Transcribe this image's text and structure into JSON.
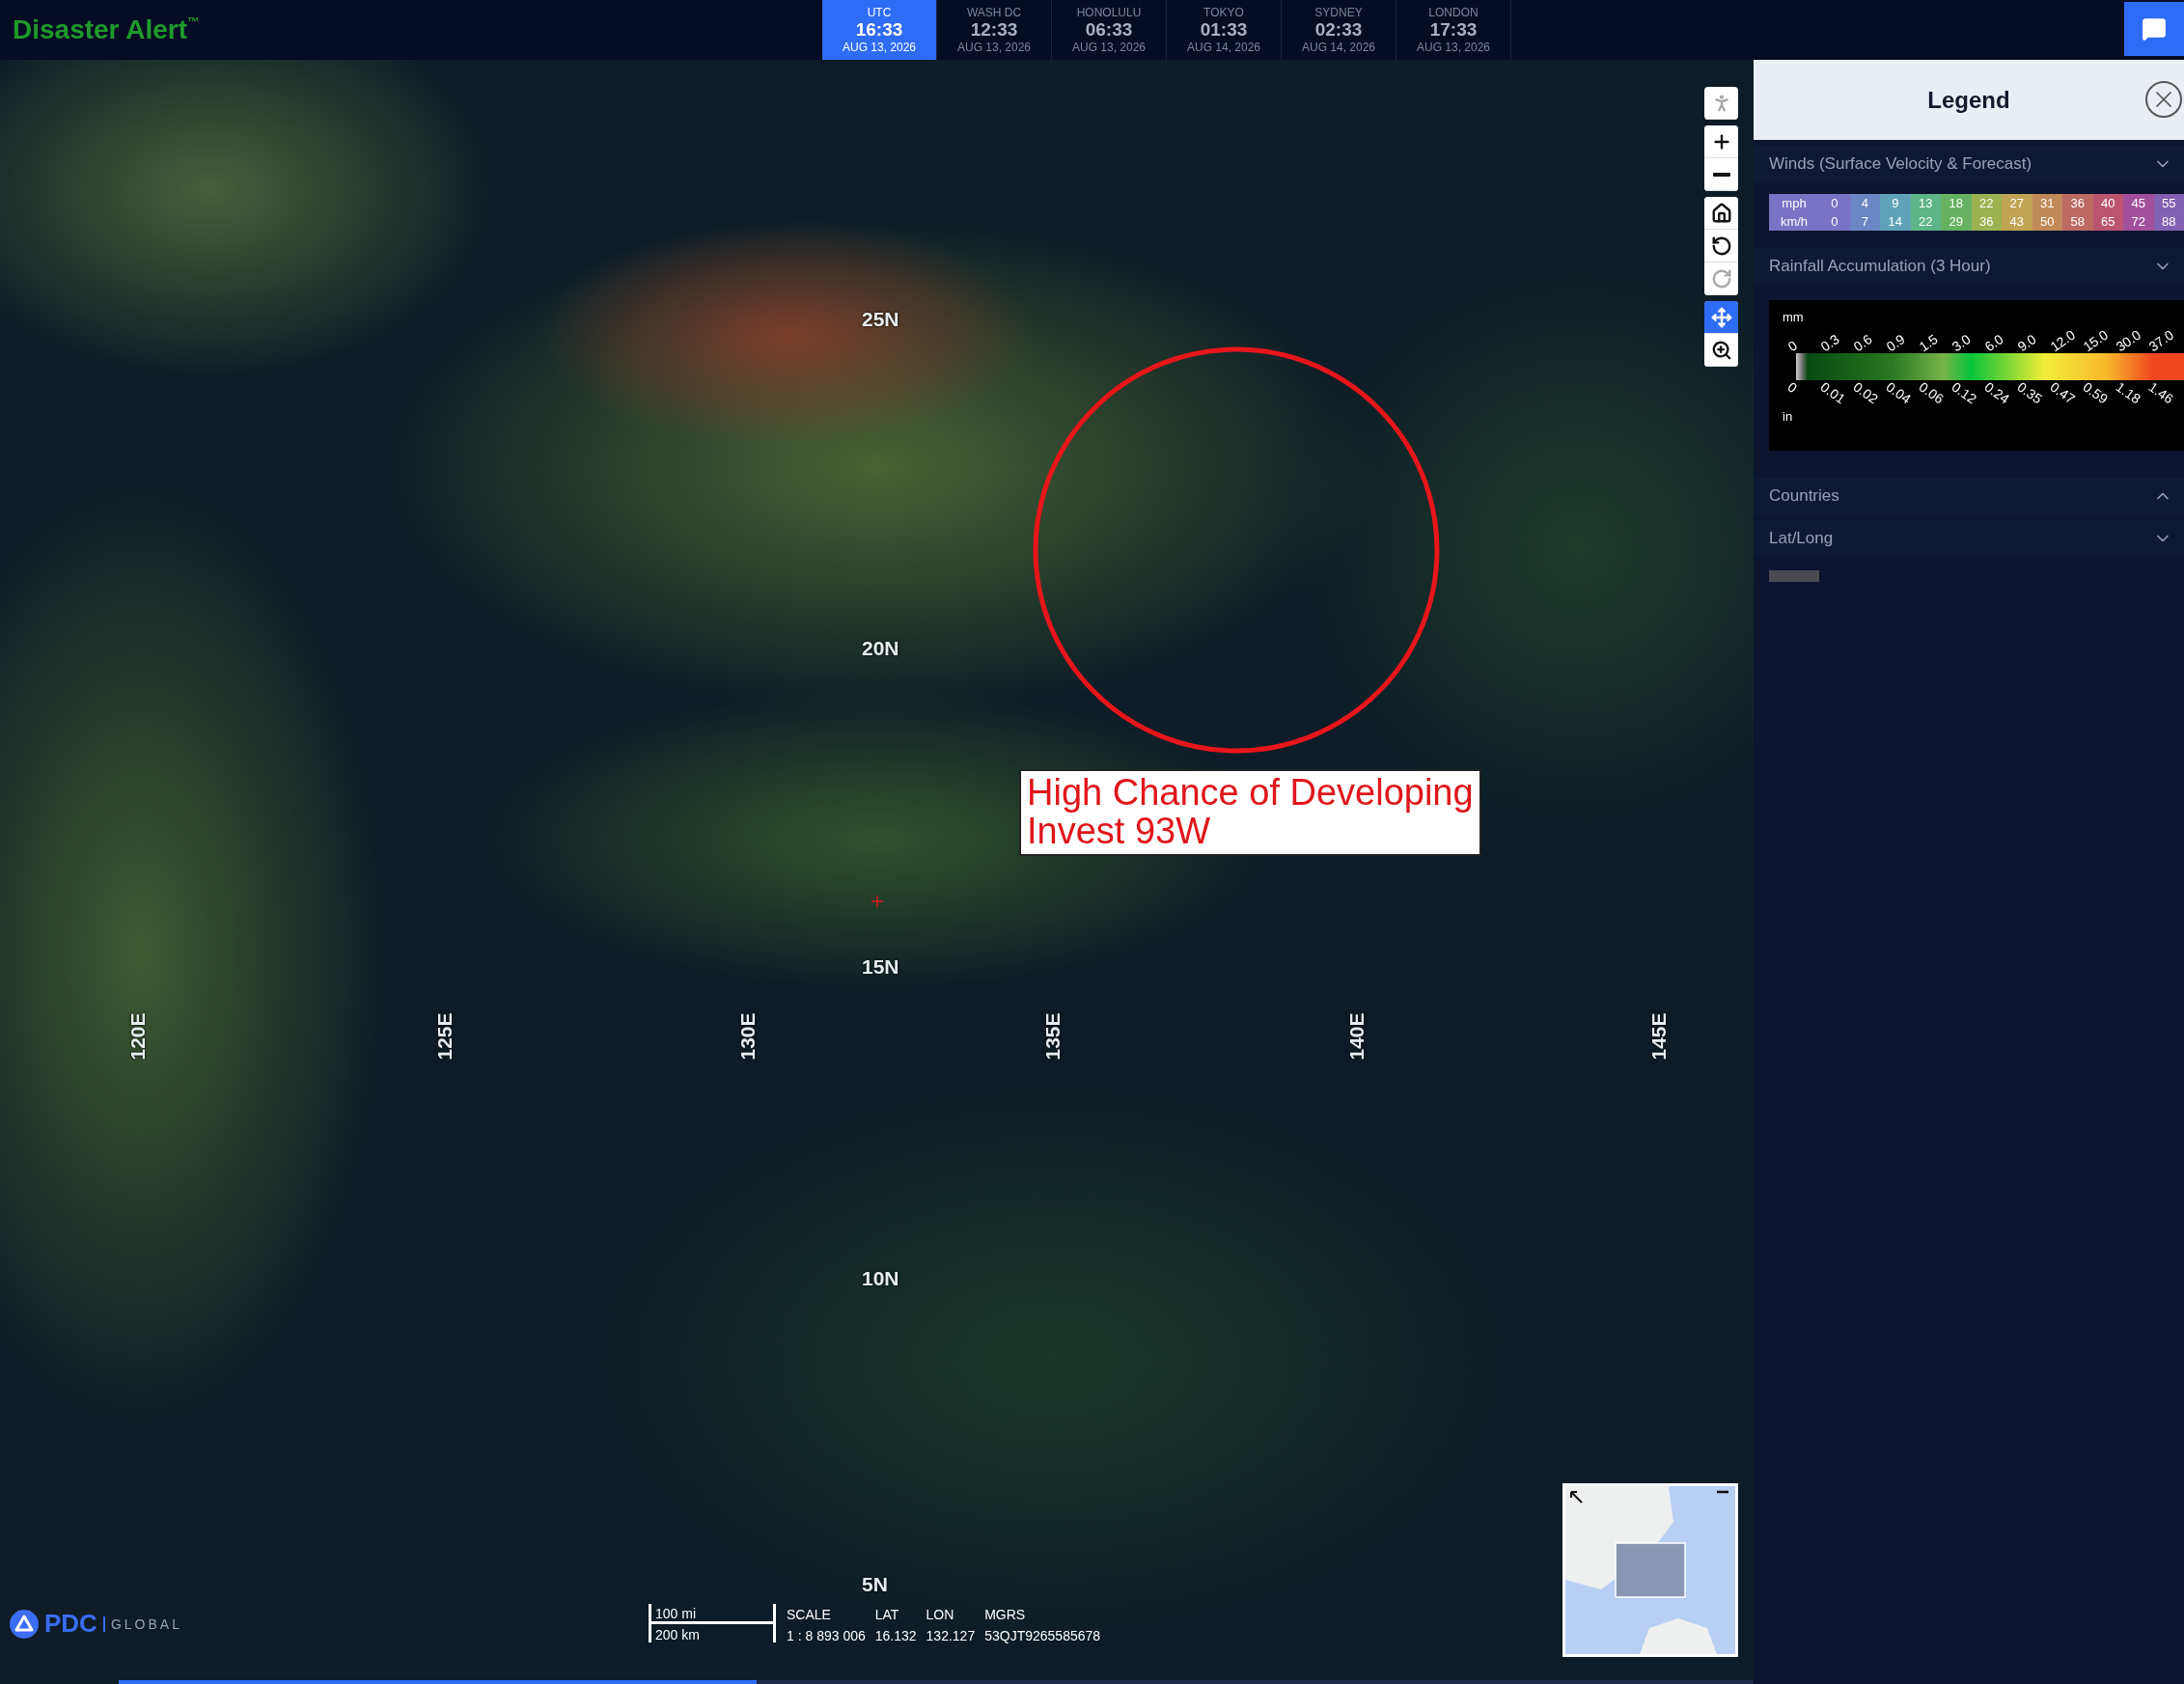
{
  "header": {
    "title": "Disaster Alert",
    "trademark": "™",
    "clocks": [
      {
        "zone": "UTC",
        "time": "16:33",
        "date": "AUG 13, 2026",
        "selected": true
      },
      {
        "zone": "WASH DC",
        "time": "12:33",
        "date": "AUG 13, 2026",
        "selected": false
      },
      {
        "zone": "HONOLULU",
        "time": "06:33",
        "date": "AUG 13, 2026",
        "selected": false
      },
      {
        "zone": "TOKYO",
        "time": "01:33",
        "date": "AUG 14, 2026",
        "selected": false
      },
      {
        "zone": "SYDNEY",
        "time": "02:33",
        "date": "AUG 14, 2026",
        "selected": false
      },
      {
        "zone": "LONDON",
        "time": "17:33",
        "date": "AUG 13, 2026",
        "selected": false
      }
    ]
  },
  "map": {
    "lat_labels": [
      "25N",
      "20N",
      "15N",
      "10N",
      "5N"
    ],
    "lon_labels": [
      "120E",
      "125E",
      "130E",
      "135E",
      "140E",
      "145E"
    ],
    "annotation": {
      "lines": [
        "High Chance of Developing",
        "Invest 93W"
      ]
    },
    "controls": [
      {
        "buttons": [
          {
            "kind": "person",
            "selected": false,
            "disabled": true
          }
        ]
      },
      {
        "buttons": [
          {
            "kind": "zoom-in",
            "selected": false,
            "disabled": false
          },
          {
            "kind": "zoom-out",
            "selected": false,
            "disabled": false
          }
        ]
      },
      {
        "buttons": [
          {
            "kind": "home",
            "selected": false,
            "disabled": false
          },
          {
            "kind": "undo",
            "selected": false,
            "disabled": false
          },
          {
            "kind": "redo",
            "selected": false,
            "disabled": true
          }
        ]
      },
      {
        "buttons": [
          {
            "kind": "pan",
            "selected": true,
            "disabled": false
          },
          {
            "kind": "zoom-box",
            "selected": false,
            "disabled": false
          }
        ]
      }
    ],
    "logo": {
      "name": "PDC",
      "suffix": "GLOBAL"
    },
    "scale_bar": {
      "miles": "100 mi",
      "km": "200 km"
    },
    "readout": [
      {
        "label": "SCALE",
        "value": "1 : 8 893 006"
      },
      {
        "label": "LAT",
        "value": "16.132"
      },
      {
        "label": "LON",
        "value": "132.127"
      },
      {
        "label": "MGRS",
        "value": "53QJT9265585678"
      }
    ],
    "timeline": {
      "level": 0.39
    }
  },
  "legend": {
    "title": "Legend",
    "sections": [
      {
        "title": "Winds (Surface Velocity & Forecast)",
        "expanded": true,
        "kind": "winds"
      },
      {
        "title": "Rainfall Accumulation (3 Hour)",
        "expanded": true,
        "kind": "rainfall"
      },
      {
        "title": "Countries",
        "expanded": false
      },
      {
        "title": "Lat/Long",
        "expanded": true,
        "kind": "swatch"
      }
    ],
    "wind_scale": {
      "row_labels": [
        "mph",
        "km/h"
      ],
      "columns": [
        {
          "mph": "0",
          "kmh": "0",
          "color": "#7a72c4"
        },
        {
          "mph": "4",
          "kmh": "7",
          "color": "#6a86c4"
        },
        {
          "mph": "9",
          "kmh": "14",
          "color": "#5fa2b8"
        },
        {
          "mph": "13",
          "kmh": "22",
          "color": "#5cb488"
        },
        {
          "mph": "18",
          "kmh": "29",
          "color": "#66b262"
        },
        {
          "mph": "22",
          "kmh": "36",
          "color": "#9cb250"
        },
        {
          "mph": "27",
          "kmh": "43",
          "color": "#c0a452"
        },
        {
          "mph": "31",
          "kmh": "50",
          "color": "#c08a58"
        },
        {
          "mph": "36",
          "kmh": "58",
          "color": "#bc6a62"
        },
        {
          "mph": "40",
          "kmh": "65",
          "color": "#bc5470"
        },
        {
          "mph": "45",
          "kmh": "72",
          "color": "#a2509c"
        },
        {
          "mph": "55",
          "kmh": "88",
          "color": "#8260b4"
        }
      ]
    },
    "rainfall_scale": {
      "mm_label": "mm",
      "in_label": "in",
      "mm": [
        "0",
        "0.3",
        "0.6",
        "0.9",
        "1.5",
        "3.0",
        "6.0",
        "9.0",
        "12.0",
        "15.0",
        "30.0",
        "37.0"
      ],
      "in": [
        "0",
        "0.01",
        "0.02",
        "0.04",
        "0.06",
        "0.12",
        "0.24",
        "0.35",
        "0.47",
        "0.59",
        "1.18",
        "1.46"
      ]
    }
  }
}
